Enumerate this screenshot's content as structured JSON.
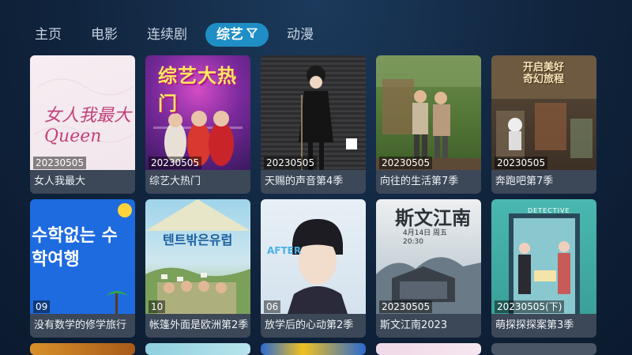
{
  "nav": {
    "tabs": [
      {
        "label": "主页"
      },
      {
        "label": "电影"
      },
      {
        "label": "连续剧"
      },
      {
        "label": "综艺"
      },
      {
        "label": "动漫"
      }
    ],
    "active_index": 3,
    "active_icon": "filter-funnel-icon"
  },
  "cards": [
    {
      "badge": "20230505",
      "title": "女人我最大",
      "poster_text": "女人我最大 Queen"
    },
    {
      "badge": "20230505",
      "title": "综艺大热门",
      "poster_text": "综艺大热门"
    },
    {
      "badge": "20230505",
      "title": "天赐的声音第4季"
    },
    {
      "badge": "20230505",
      "title": "向往的生活第7季"
    },
    {
      "badge": "20230505",
      "title": "奔跑吧第7季",
      "poster_text": "开启美好奇幻旅程"
    },
    {
      "badge": "09",
      "title": "没有数学的修学旅行",
      "poster_text": "수학없는 수학여행"
    },
    {
      "badge": "10",
      "title": "帐篷外面是欧洲第2季",
      "poster_text": "텐트밖은유럽"
    },
    {
      "badge": "06",
      "title": "放学后的心动第2季",
      "poster_text": "AFTER"
    },
    {
      "badge": "20230505",
      "title": "斯文江南2023",
      "poster_text": "斯文江南",
      "poster_subtext": "4月14日 周五20:30"
    },
    {
      "badge": "20230505(下)",
      "title": "萌探探探案第3季",
      "poster_text": "DETECTIVE"
    }
  ],
  "colors": {
    "accent": "#1e8ec4",
    "title_bar": "#3c4757"
  }
}
